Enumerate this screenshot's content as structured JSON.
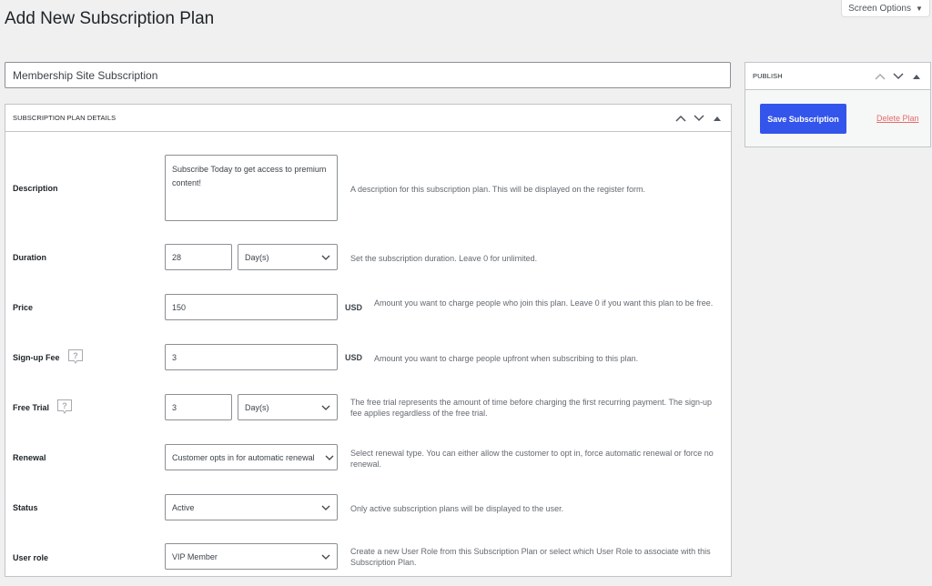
{
  "page": {
    "title": "Add New Subscription Plan",
    "screen_options_label": "Screen Options",
    "plan_name_value": "Membership Site Subscription"
  },
  "details_box": {
    "title": "SUBSCRIPTION PLAN DETAILS",
    "fields": {
      "description": {
        "label": "Description",
        "value": "Subscribe Today to get access to premium content!",
        "help": "A description for this subscription plan. This will be displayed on the register form."
      },
      "duration": {
        "label": "Duration",
        "value": "28",
        "unit": "Day(s)",
        "help": "Set the subscription duration. Leave 0 for unlimited."
      },
      "price": {
        "label": "Price",
        "value": "150",
        "currency": "USD",
        "help": "Amount you want to charge people who join this plan. Leave 0 if you want this plan to be free."
      },
      "signup_fee": {
        "label": "Sign-up Fee",
        "value": "3",
        "currency": "USD",
        "help": "Amount you want to charge people upfront when subscribing to this plan."
      },
      "free_trial": {
        "label": "Free Trial",
        "value": "3",
        "unit": "Day(s)",
        "help": "The free trial represents the amount of time before charging the first recurring payment. The sign-up fee applies regardless of the free trial."
      },
      "renewal": {
        "label": "Renewal",
        "value": "Customer opts in for automatic renewal",
        "help": "Select renewal type. You can either allow the customer to opt in, force automatic renewal or force no renewal."
      },
      "status": {
        "label": "Status",
        "value": "Active",
        "help": "Only active subscription plans will be displayed to the user."
      },
      "user_role": {
        "label": "User role",
        "value": "VIP Member",
        "help": "Create a new User Role from this Subscription Plan or select which User Role to associate with this Subscription Plan."
      }
    }
  },
  "publish_box": {
    "title": "PUBLISH",
    "save_label": "Save Subscription",
    "delete_label": "Delete Plan"
  },
  "colors": {
    "primary_button": "#3455eb",
    "delete_link": "#e86a6a",
    "background": "#f0f0f1"
  }
}
